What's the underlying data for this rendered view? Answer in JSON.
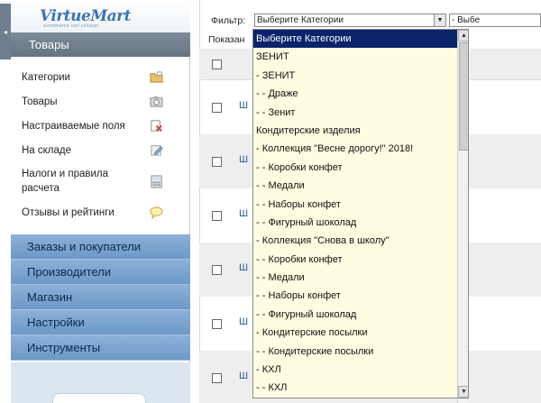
{
  "sidebar": {
    "logo": "VirtueMart",
    "logo_sub": "ecommerce cart solution",
    "collapse_icon": "◂",
    "active_section": "Товары",
    "items": [
      {
        "label": "Категории",
        "icon": "folder-icon"
      },
      {
        "label": "Товары",
        "icon": "camera-icon"
      },
      {
        "label": "Настраиваемые поля",
        "icon": "custom-fields-icon"
      },
      {
        "label": "На складе",
        "icon": "edit-icon"
      },
      {
        "label": "Налоги и правила расчета",
        "icon": "calculator-icon"
      },
      {
        "label": "Отзывы и рейтинги",
        "icon": "comment-icon"
      }
    ],
    "sections": [
      "Заказы и покупатели",
      "Производители",
      "Магазин",
      "Настройки",
      "Инструменты"
    ]
  },
  "main": {
    "filter_label": "Фильтр:",
    "category_select": "Выберите Категории",
    "second_select": "- Выбе",
    "shown_label": "Показан",
    "row_link": "Ш"
  },
  "dropdown": {
    "options": [
      "Выберите Категории",
      "ЗЕНИТ",
      "- ЗЕНИТ",
      "- - Драже",
      "- - Зенит",
      "Кондитерские изделия",
      "- Коллекция \"Весне дорогу!\" 2018!",
      "- - Коробки конфет",
      "- - Медали",
      "- - Наборы конфет",
      "- - Фигурный шоколад",
      "- Коллекция \"Снова в школу\"",
      "- - Коробки конфет",
      "- - Медали",
      "- - Наборы конфет",
      "- - Фигурный шоколад",
      "- Кондитерские посылки",
      "- - Кондитерские посылки",
      "- КХЛ",
      "- - КХЛ"
    ],
    "selected_index": 0,
    "scroll_up": "▲",
    "scroll_down": "▼"
  },
  "colors": {
    "section_bg": "#7d97b5",
    "active_section": "#6f7f8f",
    "selected_option": "#0a246a",
    "dropdown_bg": "#fffde1"
  }
}
